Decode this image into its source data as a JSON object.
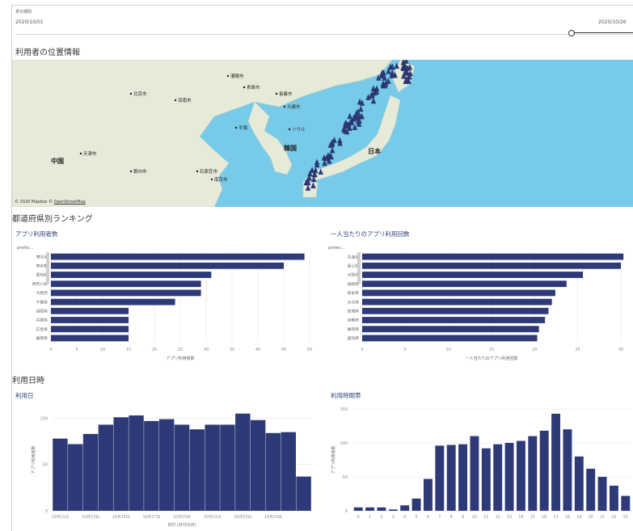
{
  "period": {
    "label": "表示期間",
    "start": "2020/10/01",
    "end": "2020/10/26"
  },
  "map": {
    "title": "利用者の位置情報",
    "attribution_prefix": "© 2020 Mapbox © ",
    "attribution_link": "OpenStreetMap",
    "places": [
      "北京市",
      "天津市",
      "中国",
      "ソウル",
      "韓国",
      "日本",
      "青島市",
      "済南市",
      "鄭州市",
      "南京市",
      "石家荘市",
      "瀋陽市",
      "大連市",
      "長春市",
      "平壌"
    ],
    "water_color": "#77cbe9",
    "land_color": "#e6ead8",
    "marker_color": "#2e3a78"
  },
  "ranking": {
    "title": "都道府県別ランキング",
    "left": {
      "title": "アプリ利用者数",
      "axis_title": "prefec...",
      "x_title": "アプリ利用者数"
    },
    "right": {
      "title": "一人当たりのアプリ利用回数",
      "axis_title": "prefec...",
      "x_title": "一人当たりのアプリ利用回数"
    }
  },
  "usage": {
    "title": "利用日時",
    "daily": {
      "title": "利用日",
      "y_title": "アプリ利用者数",
      "x_title": "日付 (日付の日)"
    },
    "hourly": {
      "title": "利用時間帯",
      "y_title": "アプリ利用者数"
    }
  },
  "chart_data": [
    {
      "type": "bar",
      "orientation": "horizontal",
      "title": "アプリ利用者数",
      "categories": [
        "埼玉県",
        "東京都",
        "愛知県",
        "神奈川県",
        "大阪府",
        "千葉県",
        "福岡県",
        "兵庫県",
        "広島県",
        "静岡県"
      ],
      "values": [
        49,
        45,
        31,
        29,
        29,
        24,
        15,
        15,
        15,
        15
      ],
      "xlim": [
        0,
        50
      ],
      "xticks": [
        0,
        5,
        10,
        15,
        20,
        25,
        30,
        35,
        40,
        45,
        50
      ],
      "bar_color": "#2e3a78"
    },
    {
      "type": "bar",
      "orientation": "horizontal",
      "title": "一人当たりのアプリ利用回数",
      "categories": [
        "北海道",
        "富山県",
        "大阪府",
        "福岡県",
        "岐阜県",
        "大分県",
        "宮城県",
        "京都府",
        "静岡県",
        "愛知県"
      ],
      "values": [
        30.3,
        30.0,
        25.6,
        23.7,
        22.4,
        22.0,
        21.6,
        21.2,
        20.5,
        20.3
      ],
      "xlim": [
        0,
        30
      ],
      "xticks": [
        0,
        5,
        10,
        15,
        20,
        25,
        30
      ],
      "bar_color": "#2e3a78"
    },
    {
      "type": "bar",
      "title": "利用日",
      "categories": [
        "10月11日",
        "",
        "10月13日",
        "",
        "10月15日",
        "",
        "10月17日",
        "",
        "10月19日",
        "",
        "10月21日",
        "",
        "10月23日",
        "",
        "10月25日"
      ],
      "values": [
        78,
        72,
        83,
        93,
        101,
        103,
        97,
        99,
        93,
        88,
        93,
        93,
        105,
        98,
        84,
        85,
        37
      ],
      "ylim": [
        0,
        110
      ],
      "yticks": [
        0,
        50,
        100
      ],
      "bar_color": "#2e3a78"
    },
    {
      "type": "bar",
      "title": "利用時間帯",
      "categories": [
        "0",
        "1",
        "2",
        "3",
        "4",
        "5",
        "6",
        "7",
        "8",
        "9",
        "10",
        "11",
        "12",
        "13",
        "14",
        "15",
        "16",
        "17",
        "18",
        "19",
        "20",
        "21",
        "22",
        "23"
      ],
      "values": [
        5,
        5,
        5,
        2,
        8,
        18,
        47,
        96,
        97,
        98,
        110,
        92,
        98,
        100,
        103,
        110,
        118,
        143,
        120,
        80,
        62,
        50,
        37,
        22
      ],
      "ylim": [
        0,
        150
      ],
      "yticks": [
        0,
        50,
        100,
        150
      ],
      "bar_color": "#2e3a78"
    }
  ]
}
